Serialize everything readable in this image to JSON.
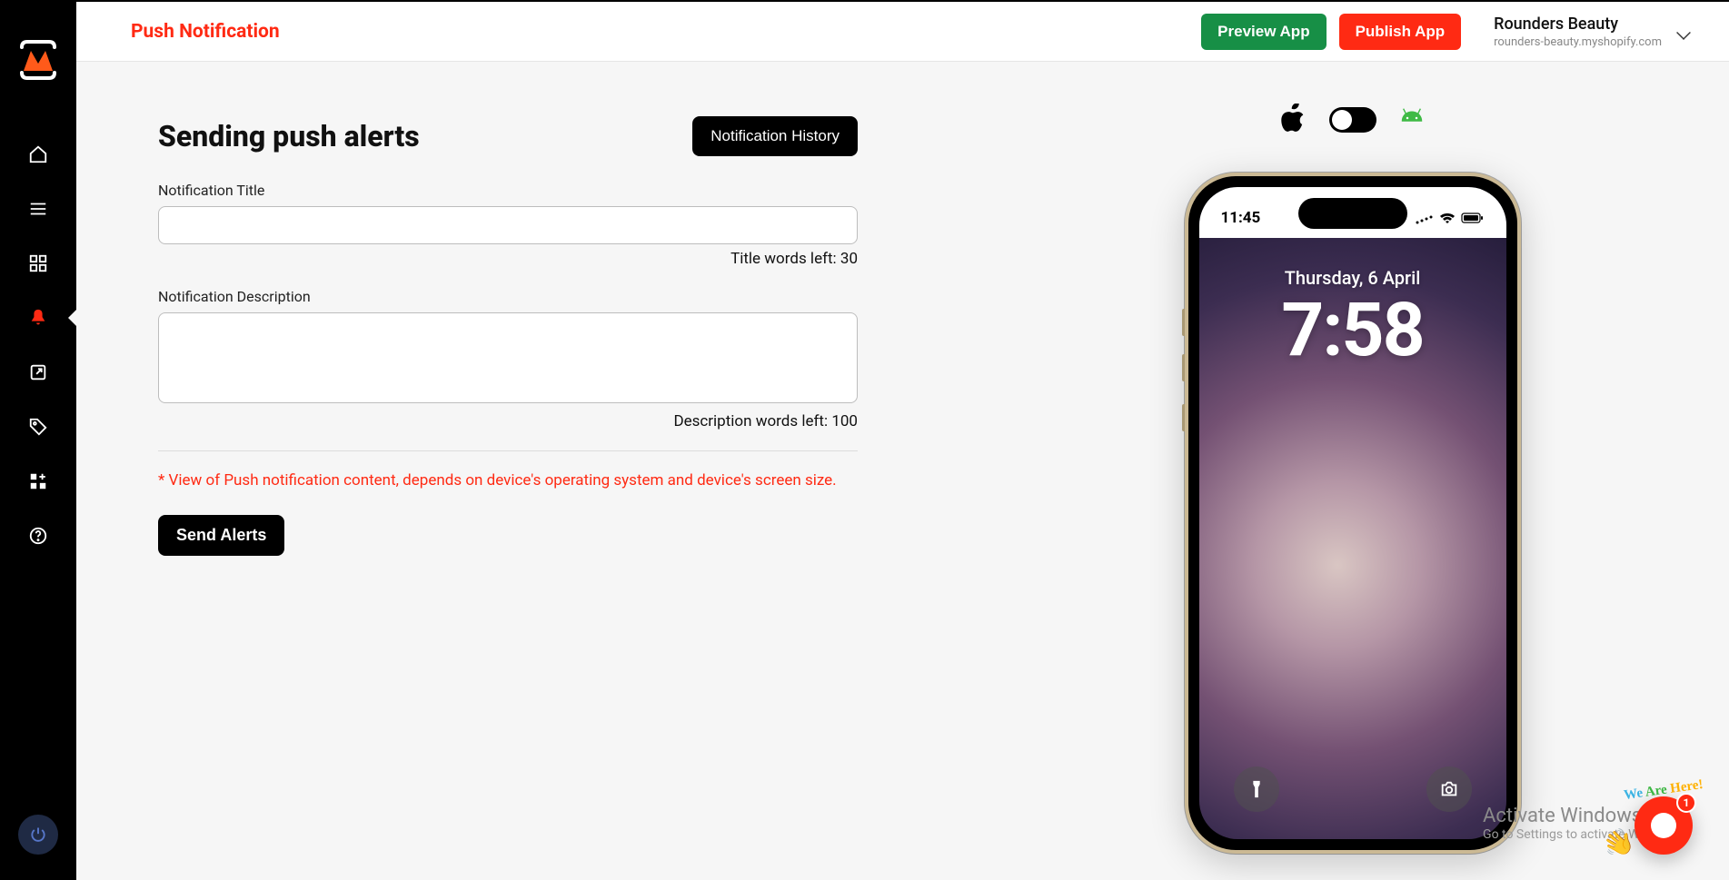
{
  "header": {
    "title": "Push Notification",
    "preview_btn": "Preview App",
    "publish_btn": "Publish App",
    "store_name": "Rounders Beauty",
    "store_domain": "rounders-beauty.myshopify.com"
  },
  "form": {
    "heading": "Sending push alerts",
    "history_btn": "Notification History",
    "title_label": "Notification Title",
    "title_value": "",
    "title_counter": "Title words left: 30",
    "desc_label": "Notification Description",
    "desc_value": "",
    "desc_counter": "Description words left: 100",
    "disclaimer": "* View of Push notification content, depends on device's operating system and device's screen size.",
    "send_btn": "Send Alerts"
  },
  "preview": {
    "status_time": "11:45",
    "lock_date": "Thursday, 6 April",
    "lock_time": "7:58"
  },
  "chat": {
    "badge": "1",
    "here_w1": "We ",
    "here_w2": "Are ",
    "here_w3": "Here!"
  },
  "watermark": {
    "l1": "Activate Windows",
    "l2": "Go to Settings to activate Windows."
  }
}
